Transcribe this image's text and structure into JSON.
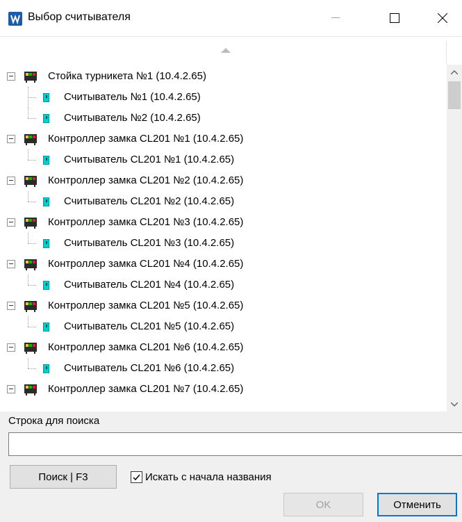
{
  "window": {
    "title": "Выбор считывателя"
  },
  "tree": {
    "nodes": [
      {
        "label": "Стойка турникета №1 (10.4.2.65)",
        "children": [
          "Считыватель №1 (10.4.2.65)",
          "Считыватель №2 (10.4.2.65)"
        ]
      },
      {
        "label": "Контроллер замка CL201 №1 (10.4.2.65)",
        "children": [
          "Считыватель CL201 №1 (10.4.2.65)"
        ]
      },
      {
        "label": "Контроллер замка CL201 №2 (10.4.2.65)",
        "children": [
          "Считыватель CL201 №2 (10.4.2.65)"
        ]
      },
      {
        "label": "Контроллер замка CL201 №3 (10.4.2.65)",
        "children": [
          "Считыватель CL201 №3 (10.4.2.65)"
        ]
      },
      {
        "label": "Контроллер замка CL201 №4 (10.4.2.65)",
        "children": [
          "Считыватель CL201 №4 (10.4.2.65)"
        ]
      },
      {
        "label": "Контроллер замка CL201 №5 (10.4.2.65)",
        "children": [
          "Считыватель CL201 №5 (10.4.2.65)"
        ]
      },
      {
        "label": "Контроллер замка CL201 №6 (10.4.2.65)",
        "children": [
          "Считыватель CL201 №6 (10.4.2.65)"
        ]
      },
      {
        "label": "Контроллер замка CL201 №7 (10.4.2.65)",
        "children": []
      }
    ]
  },
  "search": {
    "label": "Строка для поиска",
    "value": "",
    "button_label": "Поиск | F3",
    "checkbox_label": "Искать с начала названия",
    "checkbox_checked": true
  },
  "footer": {
    "ok_label": "OK",
    "cancel_label": "Отменить"
  },
  "colors": {
    "accent": "#0078d7",
    "reader": "#00d0d0"
  }
}
